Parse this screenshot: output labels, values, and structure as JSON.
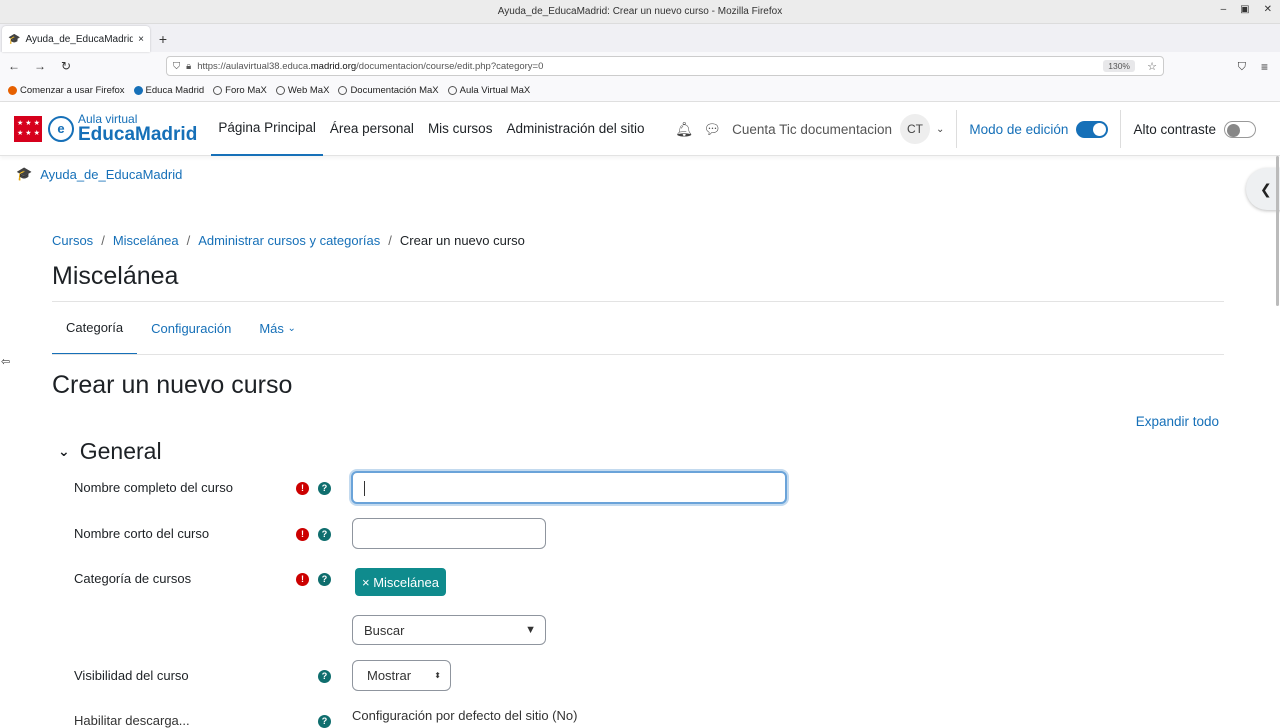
{
  "window": {
    "title": "Ayuda_de_EducaMadrid: Crear un nuevo curso - Mozilla Firefox"
  },
  "tab": {
    "title": "Ayuda_de_EducaMadrid",
    "close": "×",
    "new": "+"
  },
  "urlbar": {
    "prefix": "https://aulavirtual38.educa.",
    "host": "madrid.org",
    "path": "/documentacion/course/edit.php?category=0",
    "zoom": "130%"
  },
  "bookmarks": [
    {
      "label": "Comenzar a usar Firefox",
      "icon": "firefox-icon"
    },
    {
      "label": "Educa Madrid",
      "icon": "educamadrid-icon"
    },
    {
      "label": "Foro MaX",
      "icon": "globe-icon"
    },
    {
      "label": "Web MaX",
      "icon": "globe-icon"
    },
    {
      "label": "Documentación MaX",
      "icon": "globe-icon"
    },
    {
      "label": "Aula Virtual MaX",
      "icon": "globe-icon"
    }
  ],
  "logo": {
    "line1": "Aula virtual",
    "line2": "EducaMadrid"
  },
  "nav": {
    "home": "Página Principal",
    "personal": "Área personal",
    "courses": "Mis cursos",
    "admin": "Administración del sitio"
  },
  "user": {
    "name": "Cuenta Tic documentacion",
    "initials": "CT"
  },
  "edit_mode": {
    "label": "Modo de edición",
    "on": true
  },
  "contrast": {
    "label": "Alto contraste",
    "on": false
  },
  "site_brand": "Ayuda_de_EducaMadrid",
  "breadcrumb": [
    "Cursos",
    "Miscelánea",
    "Administrar cursos y categorías",
    "Crear un nuevo curso"
  ],
  "page_heading": "Miscelánea",
  "secondary_nav": {
    "category": "Categoría",
    "settings": "Configuración",
    "more": "Más"
  },
  "form": {
    "title": "Crear un nuevo curso",
    "expand_all": "Expandir todo",
    "section": "General",
    "fullname_label": "Nombre completo del curso",
    "fullname_value": "",
    "shortname_label": "Nombre corto del curso",
    "shortname_value": "",
    "category_label": "Categoría de cursos",
    "category_chip": "× Miscelánea",
    "search_placeholder": "Buscar",
    "visibility_label": "Visibilidad del curso",
    "visibility_value": "Mostrar",
    "next_label_partial": "Habilitar descarga...",
    "next_value_partial": "Configuración por defecto del sitio (No)"
  },
  "colors": {
    "accent": "#1670b8",
    "required": "#cc0000",
    "help": "#0f6e6e",
    "chip": "#0f8b8d"
  }
}
